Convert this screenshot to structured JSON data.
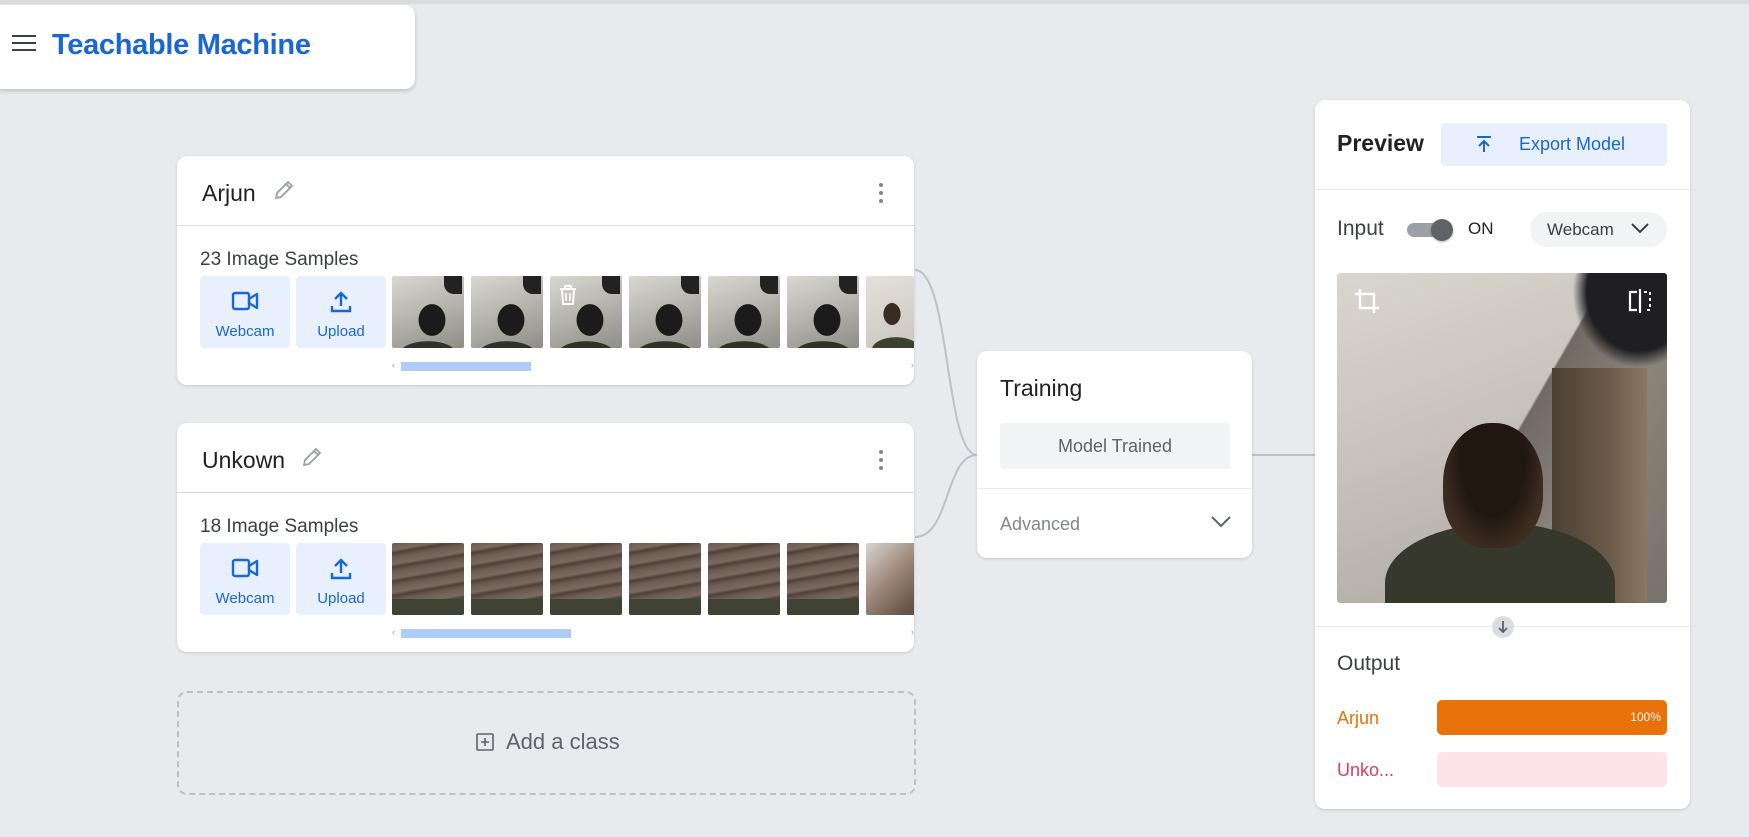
{
  "app": {
    "title": "Teachable Machine"
  },
  "classes": [
    {
      "name": "Arjun",
      "samples_label": "23 Image Samples",
      "webcam_label": "Webcam",
      "upload_label": "Upload",
      "thumbs": [
        "dark",
        "dark",
        "dark",
        "dark",
        "dark",
        "dark",
        "man"
      ],
      "scroll_fraction": 0.26
    },
    {
      "name": "Unkown",
      "samples_label": "18 Image Samples",
      "webcam_label": "Webcam",
      "upload_label": "Upload",
      "thumbs": [
        "hand",
        "hand",
        "hand",
        "hand",
        "hand",
        "hand",
        "hand2"
      ],
      "scroll_fraction": 0.34
    }
  ],
  "add_class": {
    "label": "Add a class"
  },
  "training": {
    "title": "Training",
    "button_label": "Model Trained",
    "advanced_label": "Advanced"
  },
  "preview": {
    "title": "Preview",
    "export_label": "Export Model",
    "input_label": "Input",
    "toggle_state": "ON",
    "source_select": "Webcam",
    "output_title": "Output",
    "outputs": [
      {
        "label": "Arjun",
        "percent": 100,
        "percent_label": "100%",
        "color": "#e8710a",
        "track": "#fde6d2"
      },
      {
        "label": "Unko...",
        "percent": 0,
        "percent_label": "",
        "color": "#d93b62",
        "track": "#fde4e8"
      }
    ]
  },
  "colors": {
    "accent": "#1967d2",
    "accent_bg": "#e8f0fe",
    "background": "#e8eaed"
  }
}
